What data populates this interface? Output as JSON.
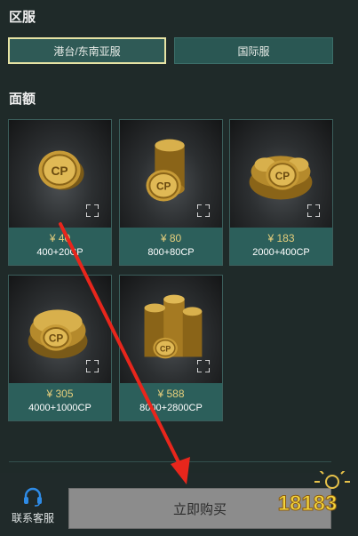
{
  "region": {
    "title": "区服",
    "options": [
      {
        "label": "港台/东南亚服",
        "selected": true
      },
      {
        "label": "国际服",
        "selected": false
      }
    ]
  },
  "denomination": {
    "title": "面额",
    "items": [
      {
        "price": "¥ 40",
        "amount": "400+20CP"
      },
      {
        "price": "¥ 80",
        "amount": "800+80CP"
      },
      {
        "price": "¥ 183",
        "amount": "2000+400CP"
      },
      {
        "price": "¥ 305",
        "amount": "4000+1000CP"
      },
      {
        "price": "¥ 588",
        "amount": "8000+2800CP"
      }
    ]
  },
  "footer": {
    "service_label": "联系客服",
    "buy_label": "立即购买"
  },
  "watermark": {
    "text": "18183"
  },
  "colors": {
    "background": "#1f2a29",
    "tile": "#2c5f5b",
    "price": "#e6cf7c",
    "selected_border": "#e6e3a4",
    "buy_button": "#8c8c8c",
    "annotation_arrow": "#e8261c"
  }
}
